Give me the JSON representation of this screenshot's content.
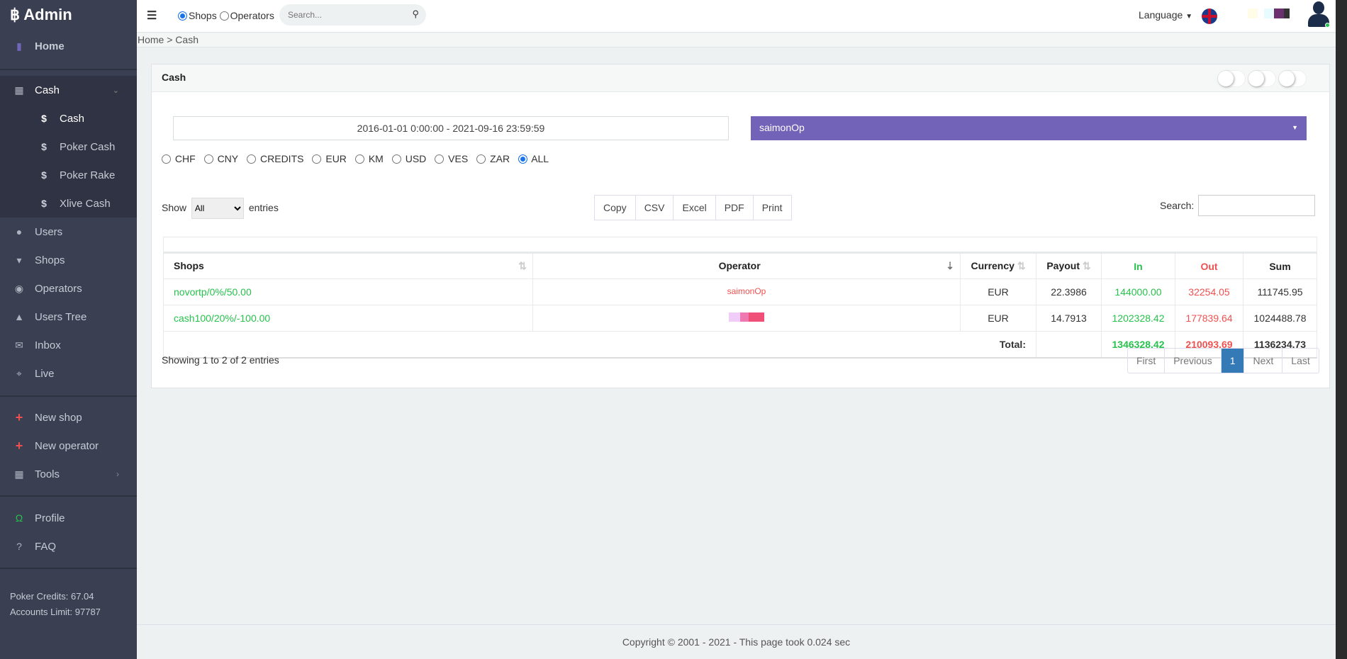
{
  "brand": {
    "title": "Admin",
    "icon": "bitcoin-icon"
  },
  "sidebar": {
    "items": [
      {
        "label": "Home",
        "icon": "bar-chart-icon"
      },
      {
        "label": "Cash",
        "icon": "grid-icon"
      },
      {
        "label": "Cash",
        "icon": "dollar-icon"
      },
      {
        "label": "Poker Cash",
        "icon": "dollar-icon"
      },
      {
        "label": "Poker Rake",
        "icon": "dollar-icon"
      },
      {
        "label": "Xlive Cash",
        "icon": "dollar-icon"
      },
      {
        "label": "Users",
        "icon": "user-icon"
      },
      {
        "label": "Shops",
        "icon": "cart-icon"
      },
      {
        "label": "Operators",
        "icon": "target-icon"
      },
      {
        "label": "Users Tree",
        "icon": "tree-icon"
      },
      {
        "label": "Inbox",
        "icon": "envelope-icon"
      },
      {
        "label": "Live",
        "icon": "crosshair-icon"
      },
      {
        "label": "New shop",
        "icon": "plus-icon"
      },
      {
        "label": "New operator",
        "icon": "plus-icon"
      },
      {
        "label": "Tools",
        "icon": "grid-icon"
      },
      {
        "label": "Profile",
        "icon": "profile-icon"
      },
      {
        "label": "FAQ",
        "icon": "question-icon"
      }
    ],
    "poker_credits": "Poker Credits: 67.04",
    "accounts_limit": "Accounts Limit: 97787"
  },
  "topbar": {
    "radio_shops": "Shops",
    "radio_operators": "Operators",
    "search_placeholder": "Search...",
    "language": "Language"
  },
  "breadcrumb": "Home > Cash",
  "card": {
    "title": "Cash",
    "date_range": "2016-01-01 0:00:00 - 2021-09-16 23:59:59",
    "operator_select": "saimonOp",
    "currencies": [
      "CHF",
      "CNY",
      "CREDITS",
      "EUR",
      "KM",
      "USD",
      "VES",
      "ZAR",
      "ALL"
    ],
    "selected_currency": "ALL",
    "show_label": "Show",
    "entries_label": "entries",
    "length_value": "All",
    "export_buttons": [
      "Copy",
      "CSV",
      "Excel",
      "PDF",
      "Print"
    ],
    "search_label": "Search:",
    "columns": [
      "Shops",
      "Operator",
      "Currency",
      "Payout",
      "In",
      "Out",
      "Sum"
    ],
    "rows": [
      {
        "shop": "novortp/0%/50.00",
        "operator": "saimonOp",
        "currency": "EUR",
        "payout": "22.3986",
        "in": "144000.00",
        "out": "32254.05",
        "sum": "111745.95"
      },
      {
        "shop": "cash100/20%/-100.00",
        "operator": "",
        "currency": "EUR",
        "payout": "14.7913",
        "in": "1202328.42",
        "out": "177839.64",
        "sum": "1024488.78"
      }
    ],
    "total_label": "Total:",
    "totals": {
      "in": "1346328.42",
      "out": "210093.69",
      "sum": "1136234.73"
    },
    "info": "Showing 1 to 2 of 2 entries",
    "pagination": [
      "First",
      "Previous",
      "1",
      "Next",
      "Last"
    ]
  },
  "colors": {
    "sidebar": "#3a3f51",
    "accent": "#7262b8",
    "in": "#27c24c",
    "out": "#f05050",
    "page_active": "#337ab7"
  },
  "footer": "Copyright © 2001 - 2021 - This page took 0.024 sec"
}
